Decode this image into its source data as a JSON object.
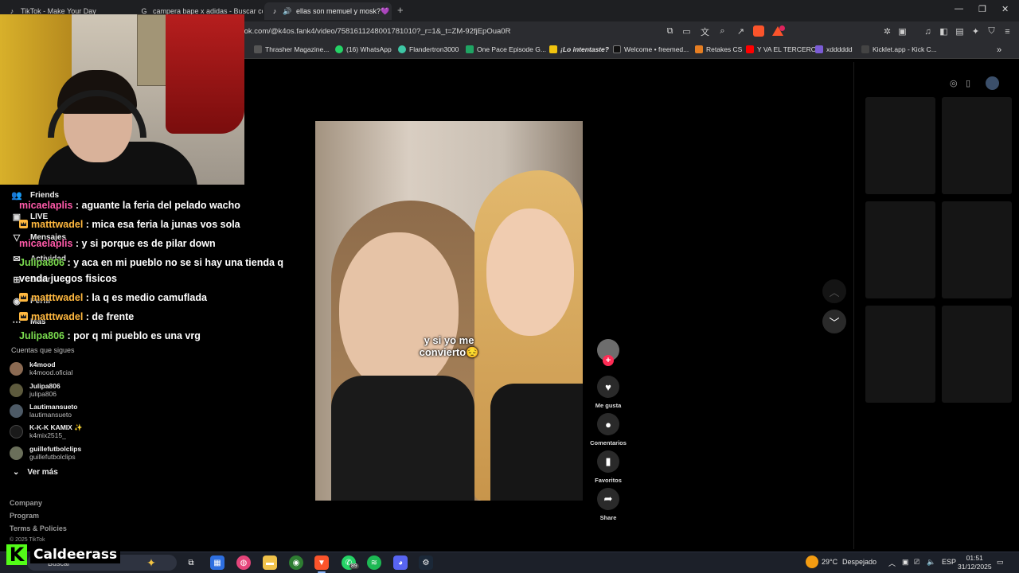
{
  "browser": {
    "tabs": [
      {
        "title": "TikTok - Make Your Day",
        "active": false
      },
      {
        "title": "campera bape x adidas - Buscar con",
        "active": false
      },
      {
        "title": "ellas son memuel y mosk?💜",
        "active": true
      }
    ],
    "url": "tok.com/@k4os.fank4/video/7581611248001781010?_r=1&_t=ZM-92fjEpOua0R",
    "bookmarks": [
      {
        "label": "Thrasher Magazine..."
      },
      {
        "label": "(16) WhatsApp"
      },
      {
        "label": "Flandertron3000"
      },
      {
        "label": "One Pace Episode G..."
      },
      {
        "label": "¡Lo intentaste?"
      },
      {
        "label": "Welcome • freemed..."
      },
      {
        "label": "Retakes CS"
      },
      {
        "label": "Y VA EL TERCERO"
      },
      {
        "label": "xdddddd"
      },
      {
        "label": "Kicklet.app - Kick C..."
      }
    ],
    "brave_badge_count": "2"
  },
  "sidebar": {
    "nav": [
      {
        "label": "Friends",
        "icon": "friends-icon"
      },
      {
        "label": "LIVE",
        "icon": "live-icon"
      },
      {
        "label": "Mensajes",
        "icon": "messages-icon"
      },
      {
        "label": "Actividad",
        "icon": "activity-icon"
      },
      {
        "label": "Subir",
        "icon": "upload-icon"
      },
      {
        "label": "Perfil",
        "icon": "profile-icon"
      },
      {
        "label": "Más",
        "icon": "more-icon"
      }
    ],
    "following_heading": "Cuentas que sigues",
    "following": [
      {
        "name": "k4mood",
        "user": "k4mood.oficial",
        "color": "#8b6a52"
      },
      {
        "name": "Julipa806",
        "user": "julipa806",
        "color": "#5d5a3d"
      },
      {
        "name": "Lautimansueto",
        "user": "lautimansueto",
        "color": "#4d5a66"
      },
      {
        "name": "K-K-K KAMIX ✨",
        "user": "k4mix2515_",
        "color": "#1a1a1a"
      },
      {
        "name": "guillefutbolclips",
        "user": "guillefutbolclips",
        "color": "#6a6f5a"
      }
    ],
    "see_more": "Ver más",
    "footer": [
      "Company",
      "Program",
      "Terms & Policies",
      "© 2025 TikTok"
    ]
  },
  "chat": [
    {
      "user": "micaelaplis",
      "color": "pink",
      "badge": false,
      "text": ": aguante la feria del pelado wacho"
    },
    {
      "user": "matttwadel",
      "color": "gold",
      "badge": true,
      "text": ": mica esa feria la junas vos sola"
    },
    {
      "user": "micaelaplis",
      "color": "pink",
      "badge": false,
      "text": ": y si porque es de pilar down"
    },
    {
      "user": "Julipa806",
      "color": "green",
      "badge": false,
      "text": ": y aca en mi pueblo no se si hay una tienda q"
    },
    {
      "user": "",
      "color": "",
      "badge": false,
      "text": "venda juegos fisicos"
    },
    {
      "user": "matttwadel",
      "color": "gold",
      "badge": true,
      "text": ": la q es medio camuflada"
    },
    {
      "user": "matttwadel",
      "color": "gold",
      "badge": true,
      "text": ": de frente"
    },
    {
      "user": "Julipa806",
      "color": "green",
      "badge": false,
      "text": ": por q mi pueblo es una vrg"
    }
  ],
  "video": {
    "caption_line1": "y si yo me",
    "caption_line2": "convierto😔"
  },
  "actions": [
    {
      "label": "Me gusta",
      "icon": "heart-icon"
    },
    {
      "label": "Comentarios",
      "icon": "comment-icon"
    },
    {
      "label": "Favoritos",
      "icon": "bookmark-icon"
    },
    {
      "label": "Share",
      "icon": "share-icon"
    }
  ],
  "overlay": {
    "kick_username": "Caldeerass"
  },
  "taskbar": {
    "search_label": "Buscar",
    "whatsapp_badge": "89",
    "weather_temp": "29°C",
    "weather_desc": "Despejado",
    "language": "ESP",
    "time": "01:51",
    "date": "31/12/2025"
  }
}
